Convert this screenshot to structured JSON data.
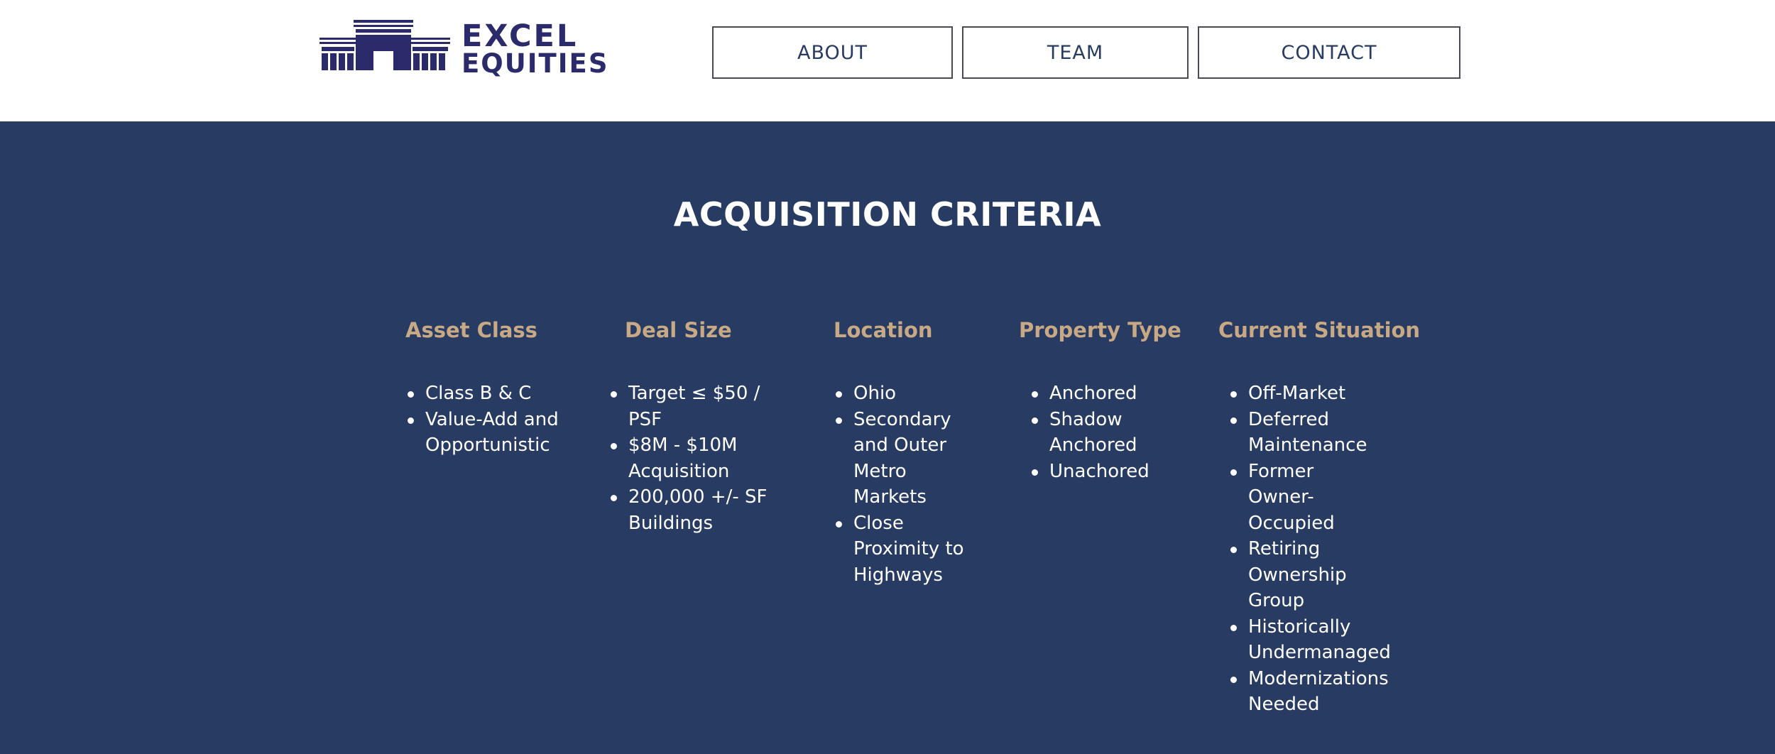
{
  "header": {
    "logo": {
      "line1": "EXCEL",
      "line2": "EQUITIES",
      "icon": "building-logo-icon"
    },
    "nav": [
      {
        "label": "ABOUT"
      },
      {
        "label": "TEAM"
      },
      {
        "label": "CONTACT"
      }
    ]
  },
  "main": {
    "title": "ACQUISITION CRITERIA",
    "columns": [
      {
        "title": "Asset Class",
        "items": [
          "Class B & C",
          "Value-Add and Opportunistic"
        ]
      },
      {
        "title": "Deal Size",
        "items": [
          "Target ≤ $50 / PSF",
          "$8M - $10M Acquisition",
          "200,000 +/- SF Buildings"
        ]
      },
      {
        "title": "Location",
        "items": [
          "Ohio",
          "Secondary and Outer Metro Markets",
          "Close Proximity to Highways"
        ]
      },
      {
        "title": "Property Type",
        "items": [
          "Anchored",
          "Shadow Anchored",
          "Unachored"
        ]
      },
      {
        "title": "Current Situation",
        "items": [
          "Off-Market",
          "Deferred Maintenance",
          "Former Owner-Occupied",
          "Retiring Ownership Group",
          "Historically Undermanaged",
          "Modernizations Needed"
        ]
      }
    ]
  },
  "colors": {
    "primary": "#283b62",
    "accent": "#c8a985",
    "logo": "#2b2a6a"
  }
}
